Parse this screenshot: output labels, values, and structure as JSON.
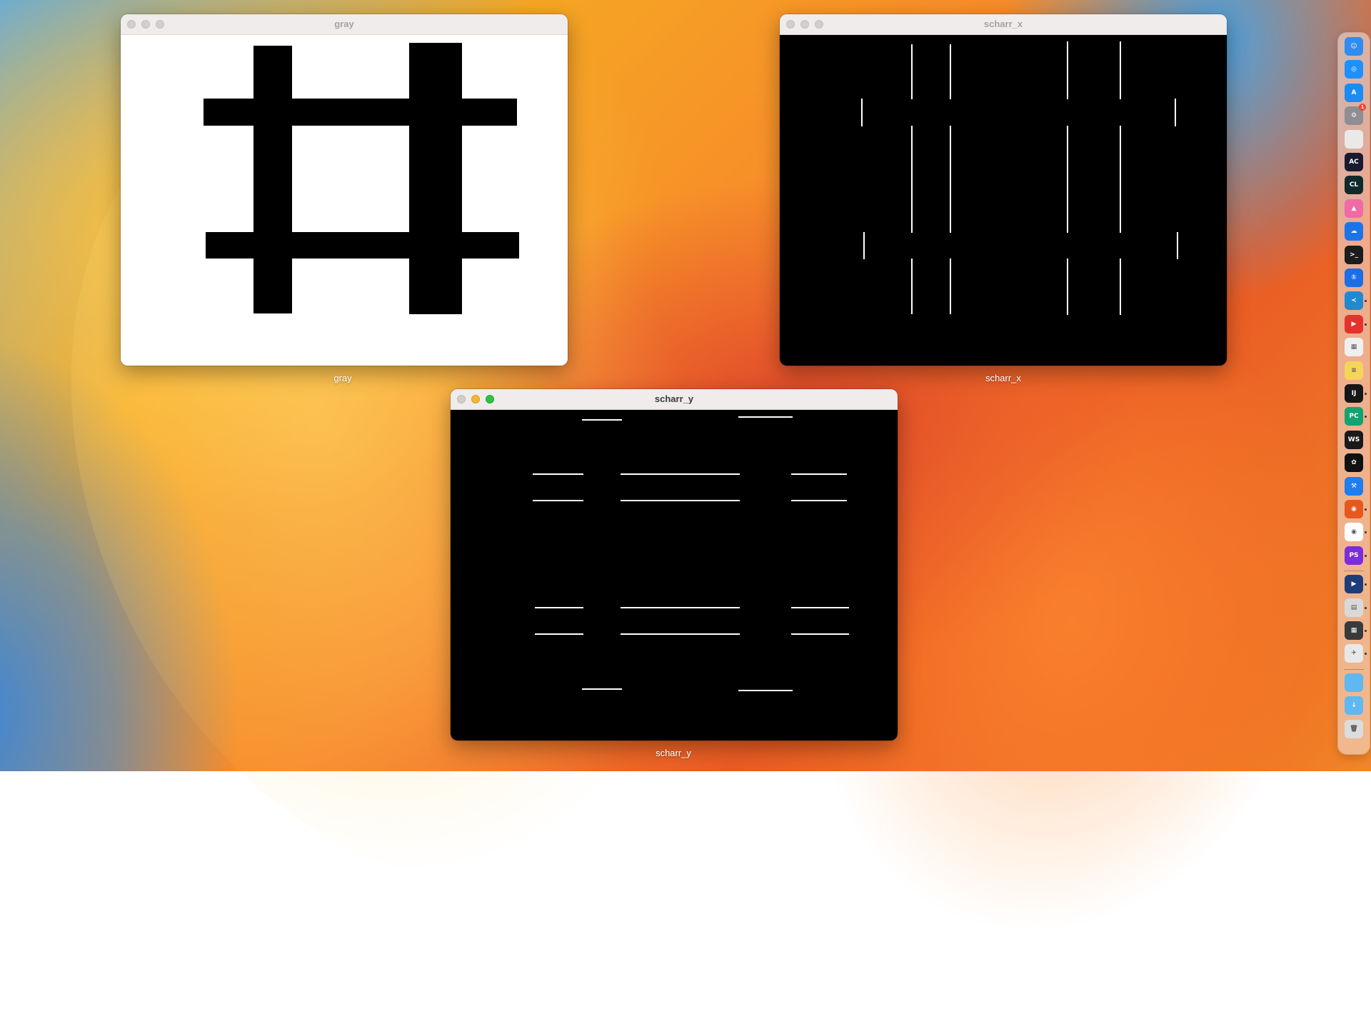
{
  "windows": {
    "gray": {
      "title": "gray",
      "label": "gray"
    },
    "scharr_x": {
      "title": "scharr_x",
      "label": "scharr_x"
    },
    "scharr_y": {
      "title": "scharr_y",
      "label": "scharr_y"
    }
  },
  "dock": {
    "items": [
      {
        "icon": "finder-icon",
        "color": "#2f8cf0",
        "glyph": "☺",
        "running": false
      },
      {
        "icon": "safari-icon",
        "color": "#1e90ff",
        "glyph": "◎",
        "running": false
      },
      {
        "icon": "app-store-icon",
        "color": "#1b8cf5",
        "glyph": "A",
        "running": false
      },
      {
        "icon": "system-settings-icon",
        "color": "#8e8e93",
        "glyph": "⚙",
        "running": false,
        "badge": "1"
      },
      {
        "icon": "notes-blank-icon",
        "color": "#e9e9e9",
        "glyph": "",
        "running": false
      },
      {
        "icon": "appcode-icon",
        "color": "#1a1a2e",
        "glyph": "AC",
        "running": false
      },
      {
        "icon": "clion-icon",
        "color": "#0f2a2a",
        "glyph": "CL",
        "running": false
      },
      {
        "icon": "pink-app-icon",
        "color": "#f06aa6",
        "glyph": "▲",
        "running": false
      },
      {
        "icon": "cloud-app-icon",
        "color": "#1d74e8",
        "glyph": "☁",
        "running": false
      },
      {
        "icon": "terminal-icon",
        "color": "#1c1c1c",
        "glyph": ">_",
        "running": false
      },
      {
        "icon": "1password-icon",
        "color": "#1a6ee8",
        "glyph": "①",
        "running": false
      },
      {
        "icon": "vscode-icon",
        "color": "#1f8ad2",
        "glyph": "≺",
        "running": true
      },
      {
        "icon": "red-app-icon",
        "color": "#e5322d",
        "glyph": "▶",
        "running": true
      },
      {
        "icon": "launchpad-icon",
        "color": "#f0f0f0",
        "glyph": "▦",
        "running": false
      },
      {
        "icon": "stickies-icon",
        "color": "#f5d45a",
        "glyph": "≡",
        "running": false
      },
      {
        "icon": "intellij-icon",
        "color": "#161616",
        "glyph": "IJ",
        "running": true
      },
      {
        "icon": "pycharm-icon",
        "color": "#12a36e",
        "glyph": "PC",
        "running": true
      },
      {
        "icon": "webstorm-icon",
        "color": "#1a1a1a",
        "glyph": "WS",
        "running": false
      },
      {
        "icon": "chatgpt-icon",
        "color": "#111111",
        "glyph": "✿",
        "running": false
      },
      {
        "icon": "xcode-icon",
        "color": "#1e7df0",
        "glyph": "⚒",
        "running": false
      },
      {
        "icon": "firefox-icon",
        "color": "#e8581d",
        "glyph": "◉",
        "running": true
      },
      {
        "icon": "chrome-icon",
        "color": "#ffffff",
        "glyph": "◉",
        "running": true
      },
      {
        "icon": "phpstorm-icon",
        "color": "#7b2cdb",
        "glyph": "PS",
        "running": true
      },
      {
        "icon": "video-app-icon",
        "color": "#1d3d7a",
        "glyph": "▶",
        "running": true
      },
      {
        "icon": "preview-icon",
        "color": "#d9d9d9",
        "glyph": "▤",
        "running": true
      },
      {
        "icon": "calculator-icon",
        "color": "#3a3a3a",
        "glyph": "▦",
        "running": true
      },
      {
        "icon": "python-rocket-icon",
        "color": "#e8e8e8",
        "glyph": "✈",
        "running": true
      },
      {
        "icon": "folder-icon",
        "color": "#5fb8f2",
        "glyph": "",
        "running": false
      },
      {
        "icon": "downloads-folder-icon",
        "color": "#5fb8f2",
        "glyph": "↓",
        "running": false
      },
      {
        "icon": "trash-icon",
        "color": "#dcdcdc",
        "glyph": "🗑",
        "running": false
      }
    ]
  }
}
